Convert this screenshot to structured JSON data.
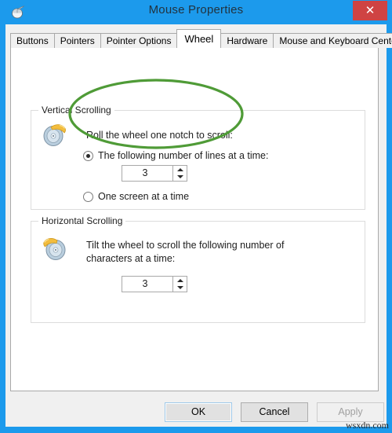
{
  "window": {
    "title": "Mouse Properties",
    "icon": "mouse-icon",
    "close_label": "✕",
    "accent_color": "#1c9aec",
    "close_color": "#cf4343"
  },
  "tabs": [
    {
      "label": "Buttons",
      "active": false
    },
    {
      "label": "Pointers",
      "active": false
    },
    {
      "label": "Pointer Options",
      "active": false
    },
    {
      "label": "Wheel",
      "active": true
    },
    {
      "label": "Hardware",
      "active": false
    },
    {
      "label": "Mouse and Keyboard Center",
      "active": false
    }
  ],
  "vertical_scrolling": {
    "group_title": "Vertical Scrolling",
    "icon": "mouse-wheel-vertical-icon",
    "description": "Roll the wheel one notch to scroll:",
    "options": [
      {
        "label": "The following number of lines at a time:",
        "selected": true
      },
      {
        "label": "One screen at a time",
        "selected": false
      }
    ],
    "spinner": {
      "value": "3",
      "up_label": "▲",
      "down_label": "▼"
    }
  },
  "horizontal_scrolling": {
    "group_title": "Horizontal Scrolling",
    "icon": "mouse-wheel-horizontal-icon",
    "description": "Tilt the wheel to scroll the following number of\ncharacters at a time:",
    "spinner": {
      "value": "3",
      "up_label": "▲",
      "down_label": "▼"
    }
  },
  "annotation": {
    "shape": "ellipse",
    "color": "#4f9b37",
    "target": "the-following-number-of-lines-option"
  },
  "footer": {
    "ok_label": "OK",
    "cancel_label": "Cancel",
    "apply_label": "Apply",
    "apply_enabled": false
  },
  "watermark": {
    "text": "wsxdn.com"
  }
}
